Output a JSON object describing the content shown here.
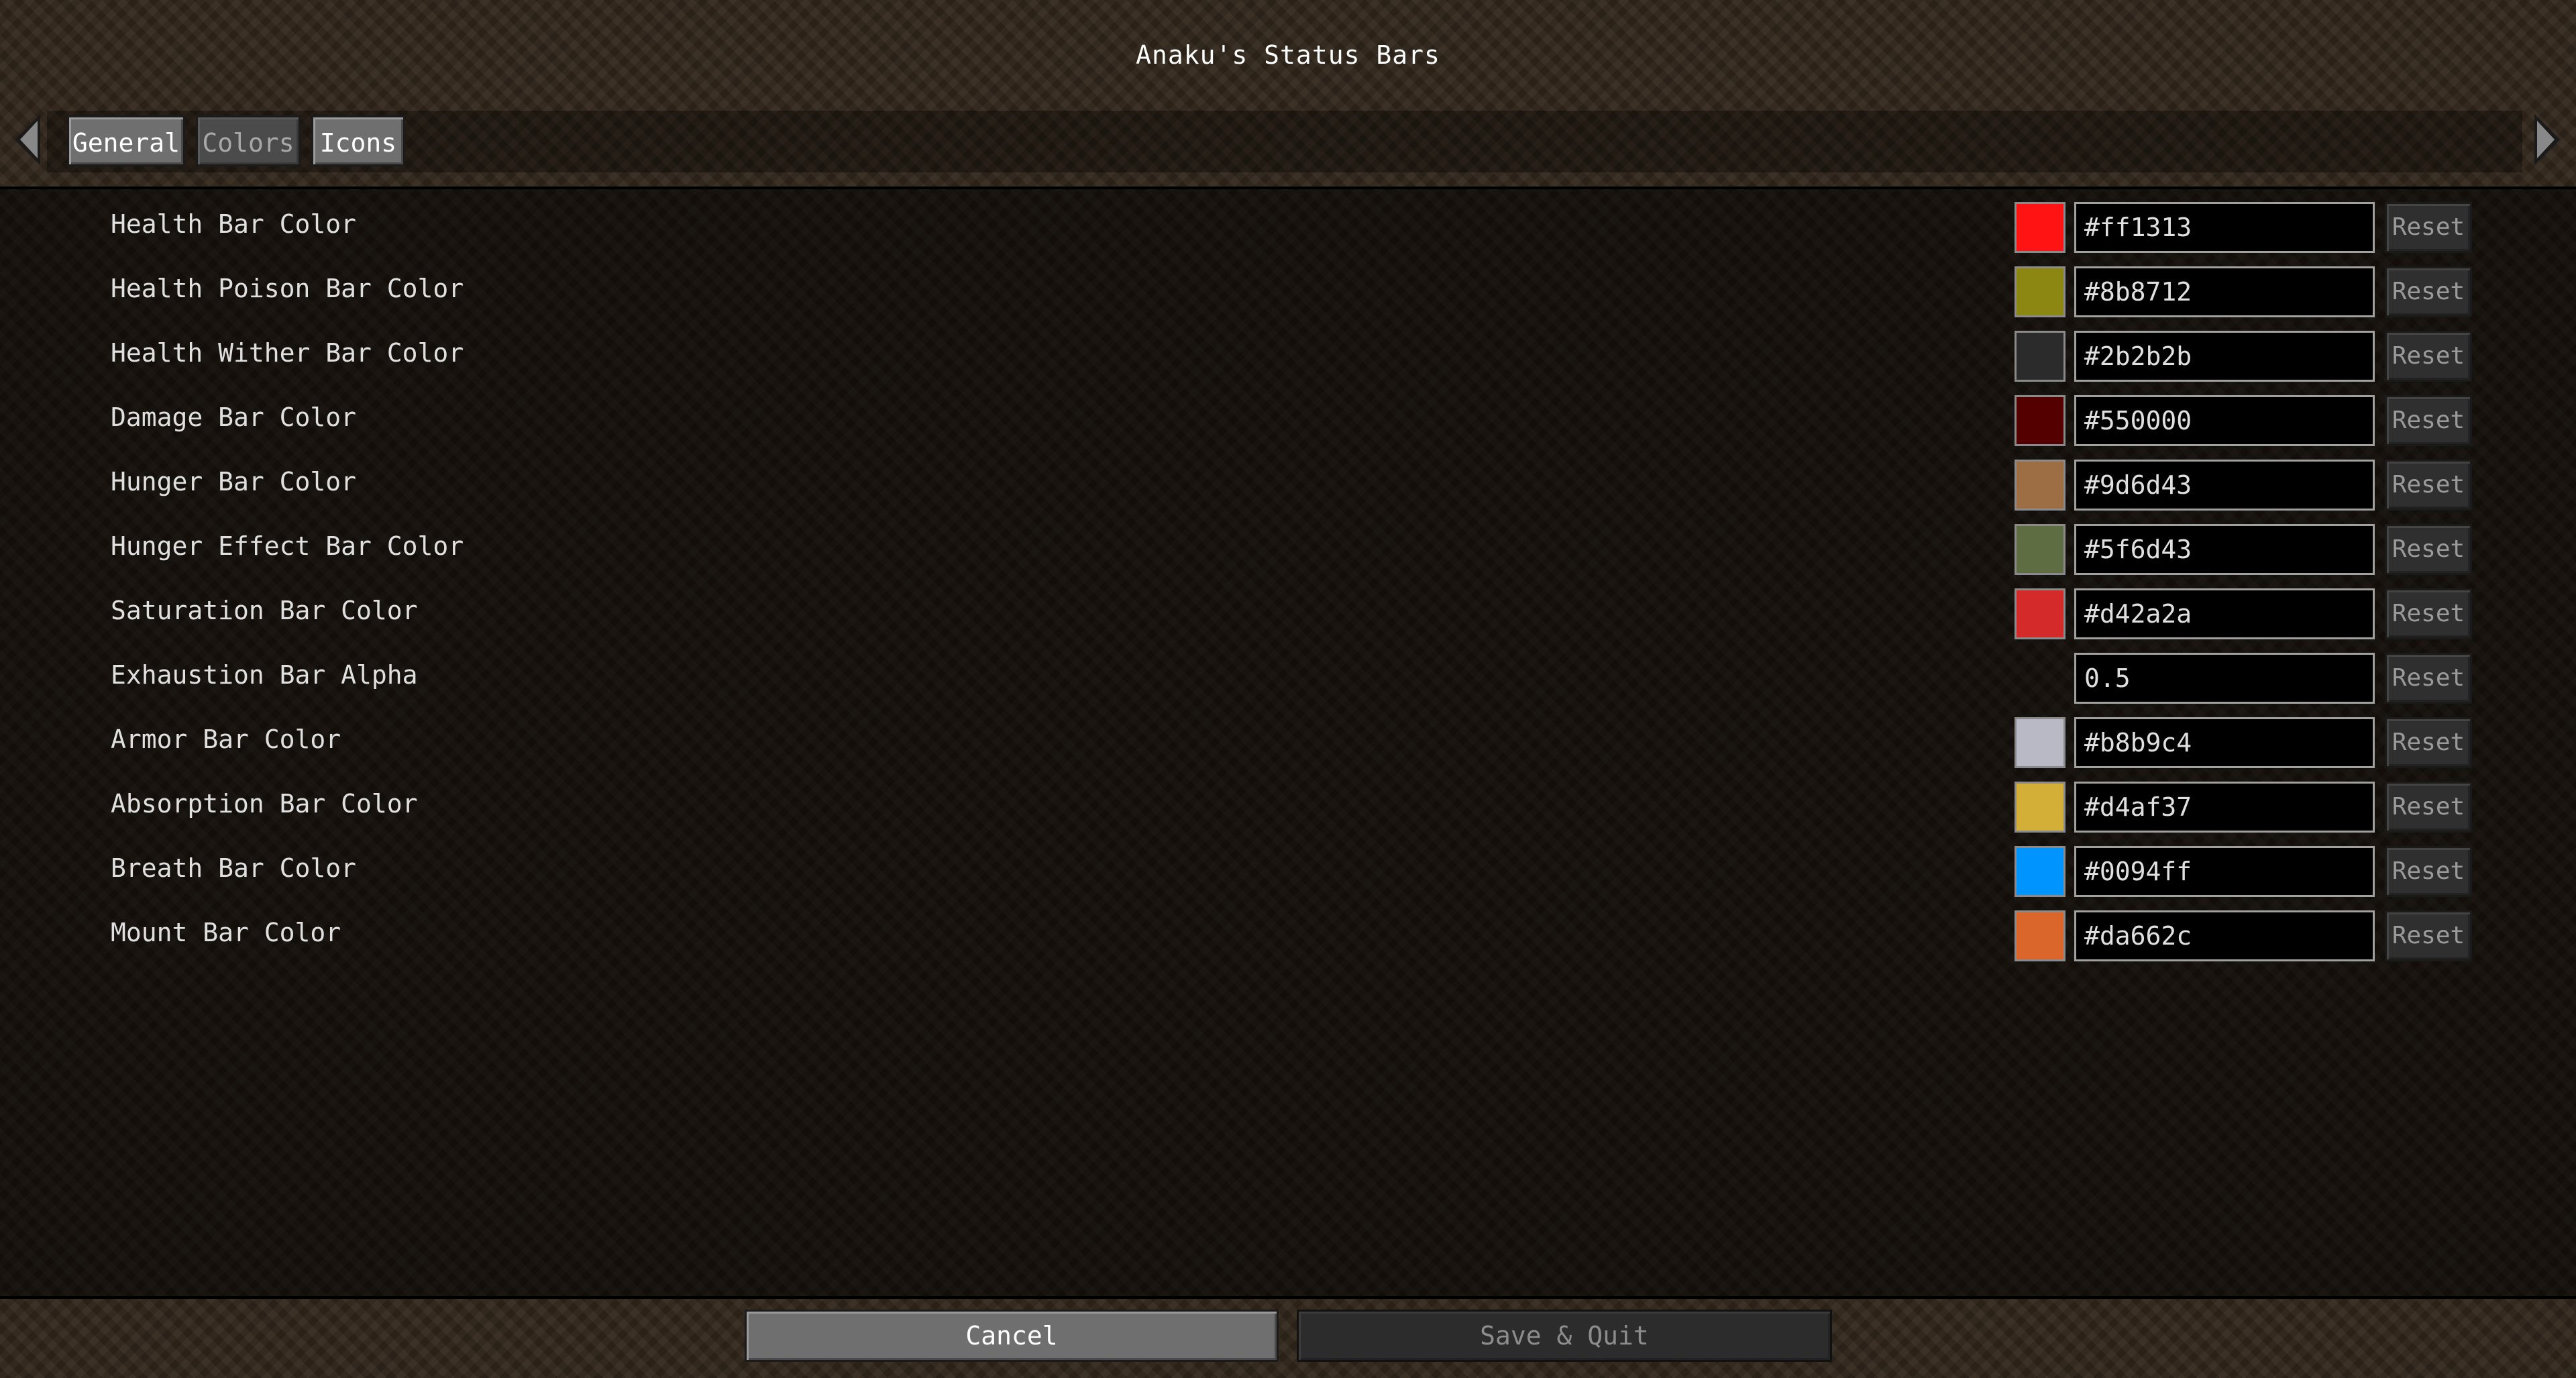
{
  "window": {
    "title": "Anaku's Status Bars"
  },
  "tabs": [
    {
      "label": "General",
      "state": "normal"
    },
    {
      "label": "Colors",
      "state": "selected"
    },
    {
      "label": "Icons",
      "state": "normal"
    }
  ],
  "rows": [
    {
      "label": "Health Bar Color",
      "value": "#ff1313",
      "swatch": "#ff1313",
      "reset_label": "Reset"
    },
    {
      "label": "Health Poison Bar Color",
      "value": "#8b8712",
      "swatch": "#8b8712",
      "reset_label": "Reset"
    },
    {
      "label": "Health Wither Bar Color",
      "value": "#2b2b2b",
      "swatch": "#2b2b2b",
      "reset_label": "Reset"
    },
    {
      "label": "Damage Bar Color",
      "value": "#550000",
      "swatch": "#550000",
      "reset_label": "Reset"
    },
    {
      "label": "Hunger Bar Color",
      "value": "#9d6d43",
      "swatch": "#9d6d43",
      "reset_label": "Reset"
    },
    {
      "label": "Hunger Effect Bar Color",
      "value": "#5f6d43",
      "swatch": "#5f6d43",
      "reset_label": "Reset"
    },
    {
      "label": "Saturation Bar Color",
      "value": "#d42a2a",
      "swatch": "#d42a2a",
      "reset_label": "Reset"
    },
    {
      "label": "Exhaustion Bar Alpha",
      "value": "0.5",
      "swatch": null,
      "reset_label": "Reset"
    },
    {
      "label": "Armor Bar Color",
      "value": "#b8b9c4",
      "swatch": "#b8b9c4",
      "reset_label": "Reset"
    },
    {
      "label": "Absorption Bar Color",
      "value": "#d4af37",
      "swatch": "#d4af37",
      "reset_label": "Reset"
    },
    {
      "label": "Breath Bar Color",
      "value": "#0094ff",
      "swatch": "#0094ff",
      "reset_label": "Reset"
    },
    {
      "label": "Mount Bar Color",
      "value": "#da662c",
      "swatch": "#da662c",
      "reset_label": "Reset"
    }
  ],
  "footer": {
    "cancel_label": "Cancel",
    "save_label": "Save & Quit"
  }
}
